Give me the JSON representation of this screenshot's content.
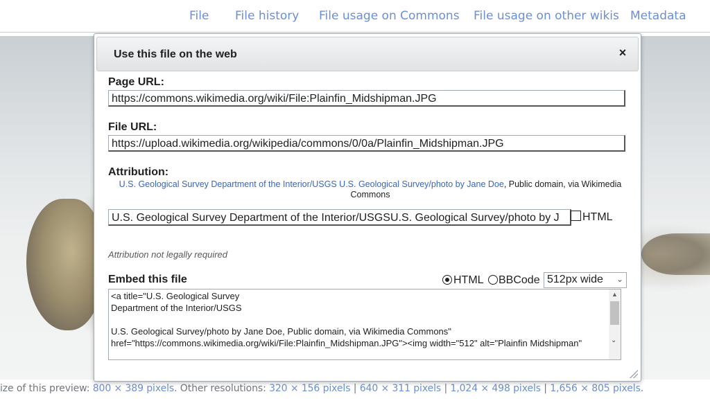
{
  "tabs": [
    "File",
    "File history",
    "File usage on Commons",
    "File usage on other wikis",
    "Metadata"
  ],
  "dialog": {
    "title": "Use this file on the web",
    "close_label": "×",
    "page_url_label": "Page URL:",
    "page_url": "https://commons.wikimedia.org/wiki/File:Plainfin_Midshipman.JPG",
    "file_url_label": "File URL:",
    "file_url": "https://upload.wikimedia.org/wikipedia/commons/0/0a/Plainfin_Midshipman.JPG",
    "attribution_label": "Attribution:",
    "attribution_link": "U.S. Geological Survey Department of the Interior/USGS U.S. Geological Survey/photo by Jane Doe",
    "attribution_rest": ", Public domain, via Wikimedia Commons",
    "attribution_field": "U.S. Geological Survey Department of the Interior/USGSU.S. Geological Survey/photo by J",
    "html_check_label": "HTML",
    "note": "Attribution not legally required",
    "embed_label": "Embed this file",
    "radio_html": "HTML",
    "radio_bbcode": "BBCode",
    "size_select": "512px wide",
    "embed_code": "<a title=\"U.S. Geological Survey\nDepartment of the Interior/USGS\n\nU.S. Geological Survey/photo by Jane Doe, Public domain, via Wikimedia Commons\" href=\"https://commons.wikimedia.org/wiki/File:Plainfin_Midshipman.JPG\"><img width=\"512\" alt=\"Plainfin Midshipman\""
  },
  "footer": {
    "prefix": "ize of this preview: ",
    "preview": "800 × 389 pixels",
    "other": ". Other resolutions: ",
    "res1": "320 × 156 pixels",
    "res2": "640 × 311 pixels",
    "res3": "1,024 × 498 pixels",
    "res4": "1,656 × 805 pixels",
    "sep": " | ",
    "end": "."
  }
}
